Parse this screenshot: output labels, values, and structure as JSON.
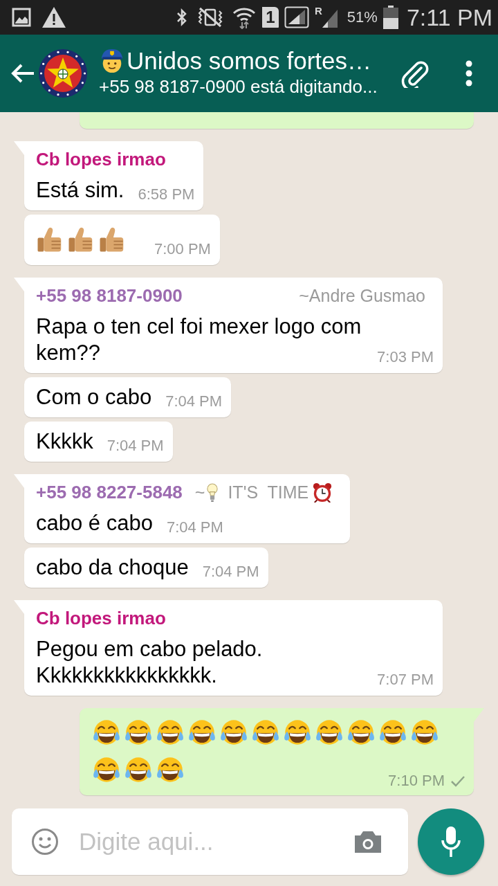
{
  "status_bar": {
    "sim_slot": "1",
    "roaming": "R",
    "battery": "51%",
    "time": "7:11 PM"
  },
  "header": {
    "title": [
      {
        "kind": "police_officer"
      },
      {
        "kind": "text",
        "text": "Unidos somos fortes…"
      }
    ],
    "subtitle": "+55 98 8187-0900 está digitando..."
  },
  "messages": [
    {
      "kind": "outgoing",
      "tail": false,
      "cut_off": true
    },
    {
      "kind": "incoming",
      "tail": true,
      "cut_off": false,
      "sender": {
        "name": "Cb lopes irmao",
        "color": "#c2187b"
      },
      "text": "Está sim.",
      "time": "6:58 PM"
    },
    {
      "kind": "incoming",
      "tail": false,
      "cut_off": false,
      "emoji": [
        {
          "kind": "thumbs_up"
        },
        {
          "kind": "thumbs_up"
        },
        {
          "kind": "thumbs_up"
        }
      ],
      "time": "7:00 PM"
    },
    {
      "kind": "incoming",
      "tail": true,
      "cut_off": false,
      "sender": {
        "name": "+55 98 8187-0900",
        "color": "#9c6bb0",
        "push_name": [
          {
            "kind": "text",
            "text": "~Andre Gusmao"
          }
        ]
      },
      "text": "Rapa o ten cel foi mexer logo com kem??",
      "time": "7:03 PM"
    },
    {
      "kind": "incoming",
      "tail": false,
      "cut_off": false,
      "text": "Com o cabo",
      "time": "7:04 PM"
    },
    {
      "kind": "incoming",
      "tail": false,
      "cut_off": false,
      "text": "Kkkkk",
      "time": "7:04 PM"
    },
    {
      "kind": "incoming",
      "tail": true,
      "cut_off": false,
      "sender": {
        "name": "+55 98 8227-5848",
        "color": "#9c6bb0",
        "push_name": [
          {
            "kind": "text",
            "text": "~"
          },
          {
            "kind": "lightbulb"
          },
          {
            "kind": "text",
            "text": "IT'S  TIME"
          },
          {
            "kind": "alarm_clock"
          }
        ]
      },
      "text": "cabo é cabo",
      "time": "7:04 PM"
    },
    {
      "kind": "incoming",
      "tail": false,
      "cut_off": false,
      "text": "cabo da choque",
      "time": "7:04 PM"
    },
    {
      "kind": "incoming",
      "tail": true,
      "cut_off": false,
      "sender": {
        "name": "Cb lopes irmao",
        "color": "#c2187b"
      },
      "text": "Pegou em cabo pelado. Kkkkkkkkkkkkkkkk.",
      "time": "7:07 PM"
    },
    {
      "kind": "outgoing",
      "tail": true,
      "cut_off": false,
      "emoji": [
        {
          "kind": "tears_of_joy"
        },
        {
          "kind": "tears_of_joy"
        },
        {
          "kind": "tears_of_joy"
        },
        {
          "kind": "tears_of_joy"
        },
        {
          "kind": "tears_of_joy"
        },
        {
          "kind": "tears_of_joy"
        },
        {
          "kind": "tears_of_joy"
        },
        {
          "kind": "tears_of_joy"
        },
        {
          "kind": "tears_of_joy"
        },
        {
          "kind": "tears_of_joy"
        },
        {
          "kind": "tears_of_joy"
        },
        {
          "kind": "tears_of_joy"
        },
        {
          "kind": "tears_of_joy"
        },
        {
          "kind": "tears_of_joy"
        }
      ],
      "time": "7:10 PM",
      "delivered": false
    }
  ],
  "composer": {
    "placeholder": "Digite aqui..."
  }
}
